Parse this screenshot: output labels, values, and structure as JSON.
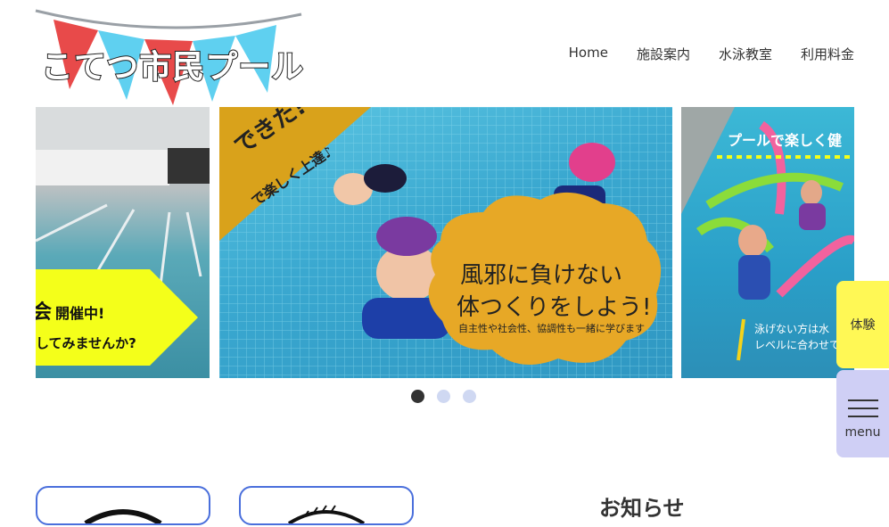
{
  "logo": {
    "text": "こてつ市民プール"
  },
  "nav": [
    "Home",
    "施設案内",
    "水泳教室",
    "利用料金"
  ],
  "slides": {
    "left": {
      "line1": "開催中!",
      "line2": "してみませんか?",
      "mark": "会"
    },
    "center": {
      "corner1": "できた!",
      "corner2": "で楽しく上達♪",
      "bubble1": "風邪に負けない",
      "bubble2": "体つくりをしよう!",
      "bubble3": "自主性や社会性、協調性も一緒に学びます"
    },
    "right": {
      "banner": "プールで楽しく健",
      "note1": "泳げない方は水",
      "note2": "レベルに合わせて"
    }
  },
  "side": {
    "trial": "体験",
    "menu": "menu"
  },
  "news": {
    "title": "お知らせ"
  }
}
